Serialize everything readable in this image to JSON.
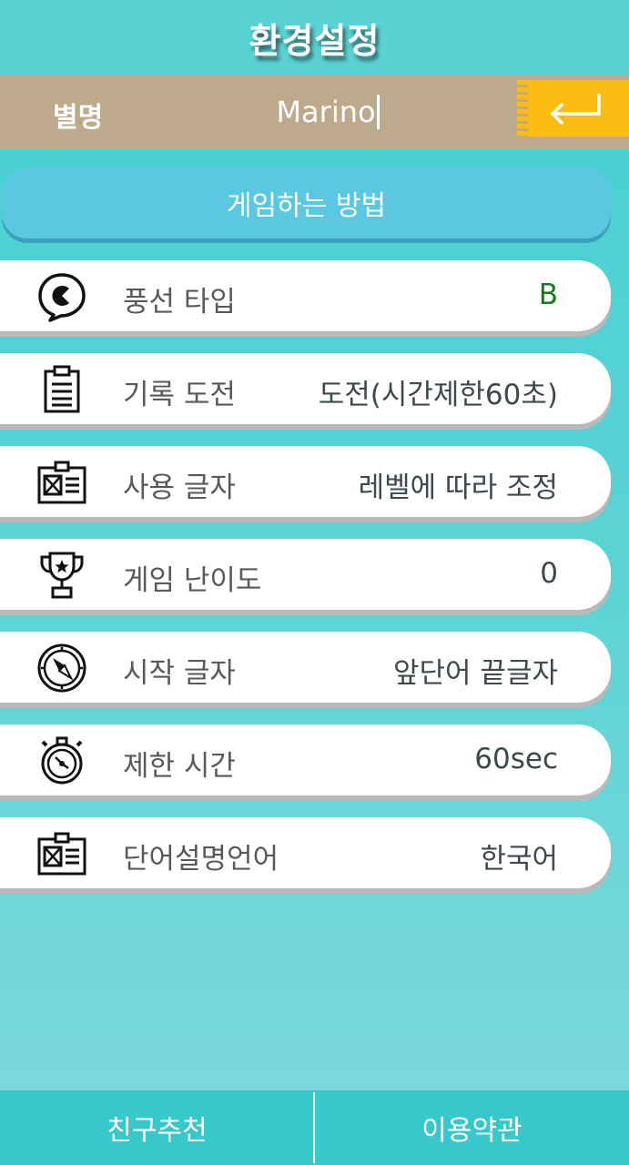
{
  "title": "환경설정",
  "nickname": {
    "label": "별명",
    "value": "Marino"
  },
  "howto_label": "게임하는 방법",
  "settings": [
    {
      "label": "풍선 타입",
      "value": "B",
      "icon": "balloon-icon"
    },
    {
      "label": "기록 도전",
      "value": "도전(시간제한60초)",
      "icon": "clipboard-icon"
    },
    {
      "label": "사용 글자",
      "value": "레벨에 따라 조정",
      "icon": "id-card-icon"
    },
    {
      "label": "게임 난이도",
      "value": "0",
      "icon": "trophy-icon"
    },
    {
      "label": "시작 글자",
      "value": "앞단어 끝글자",
      "icon": "compass-icon"
    },
    {
      "label": "제한 시간",
      "value": "60sec",
      "icon": "stopwatch-icon"
    },
    {
      "label": "단어설명언어",
      "value": "한국어",
      "icon": "id-card-icon"
    }
  ],
  "bottom": {
    "left": "친구추천",
    "right": "이용약관"
  },
  "colors": {
    "accent": "#5ad2d3",
    "nick_bar": "#bda98c",
    "enter": "#fbbc14",
    "howto": "#5ac8e0",
    "value_green": "#177a1a"
  }
}
